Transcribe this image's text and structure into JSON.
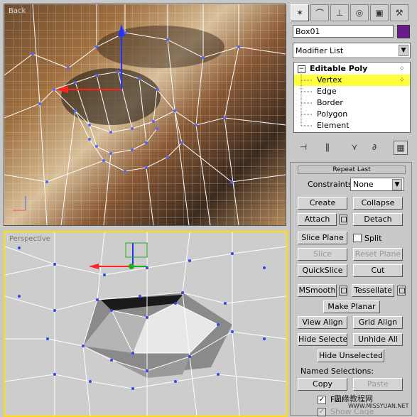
{
  "viewport_back": {
    "label": "Back"
  },
  "viewport_persp": {
    "label": "Perspective"
  },
  "toolbar": {
    "icons": [
      "create-icon",
      "modify-icon",
      "hierarchy-icon",
      "motion-icon",
      "display-icon",
      "utilities-icon"
    ]
  },
  "object_name": "Box01",
  "object_color": "#6a1a8a",
  "modifier_list": "Modifier List",
  "stack": {
    "root": "Editable Poly",
    "items": [
      "Vertex",
      "Edge",
      "Border",
      "Polygon",
      "Element"
    ],
    "selected": "Vertex"
  },
  "edit_geometry": {
    "header": "Repeat Last",
    "constraints_label": "Constraints:",
    "constraints_value": "None",
    "create": "Create",
    "collapse": "Collapse",
    "attach": "Attach",
    "detach": "Detach",
    "slice_plane": "Slice Plane",
    "split": "Split",
    "slice": "Slice",
    "reset_plane": "Reset Plane",
    "quickslice": "QuickSlice",
    "cut": "Cut",
    "msmooth": "MSmooth",
    "tessellate": "Tessellate",
    "make_planar": "Make Planar",
    "view_align": "View Align",
    "grid_align": "Grid Align",
    "hide_selected": "Hide Selected",
    "unhide_all": "Unhide All",
    "hide_unselected": "Hide Unselected",
    "named_selections": "Named Selections:",
    "copy": "Copy",
    "paste": "Paste",
    "full_interactivity": "Full",
    "show_cage": "Show Cage"
  },
  "watermark": {
    "line1": "思缘教程网",
    "line2": "WWW.MISSYUAN.NET"
  }
}
